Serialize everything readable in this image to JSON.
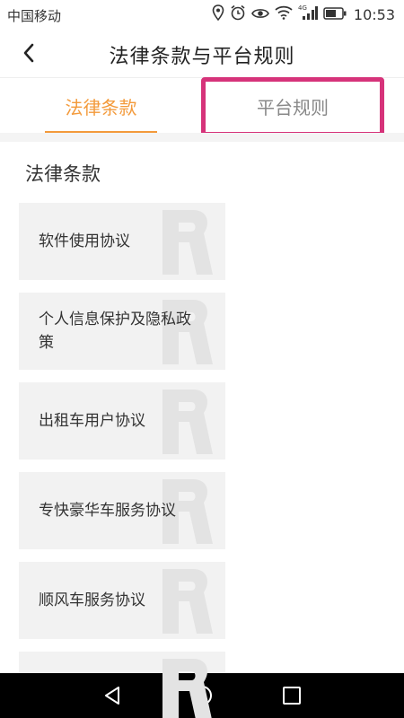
{
  "status_bar": {
    "carrier": "中国移动",
    "network": "4G",
    "time": "10:53",
    "icons": [
      "location-icon",
      "alarm-icon",
      "eye-icon",
      "wifi-icon",
      "signal-icon",
      "battery-icon"
    ]
  },
  "header": {
    "title": "法律条款与平台规则",
    "back_icon": "chevron-left-icon"
  },
  "tabs": [
    {
      "label": "法律条款",
      "active": true
    },
    {
      "label": "平台规则",
      "active": false
    }
  ],
  "section": {
    "title": "法律条款",
    "items": [
      {
        "label": "软件使用协议"
      },
      {
        "label": "个人信息保护及隐私政策"
      },
      {
        "label": "出租车用户协议"
      },
      {
        "label": "专快豪华车服务协议"
      },
      {
        "label": "顺风车服务协议"
      },
      {
        "label": ""
      }
    ]
  },
  "nav_bar": {
    "icons": [
      "back-triangle-icon",
      "home-circle-icon",
      "recents-square-icon"
    ]
  },
  "colors": {
    "accent": "#f39a3b",
    "highlight": "#d6337a",
    "card_bg": "#f2f2f2"
  }
}
